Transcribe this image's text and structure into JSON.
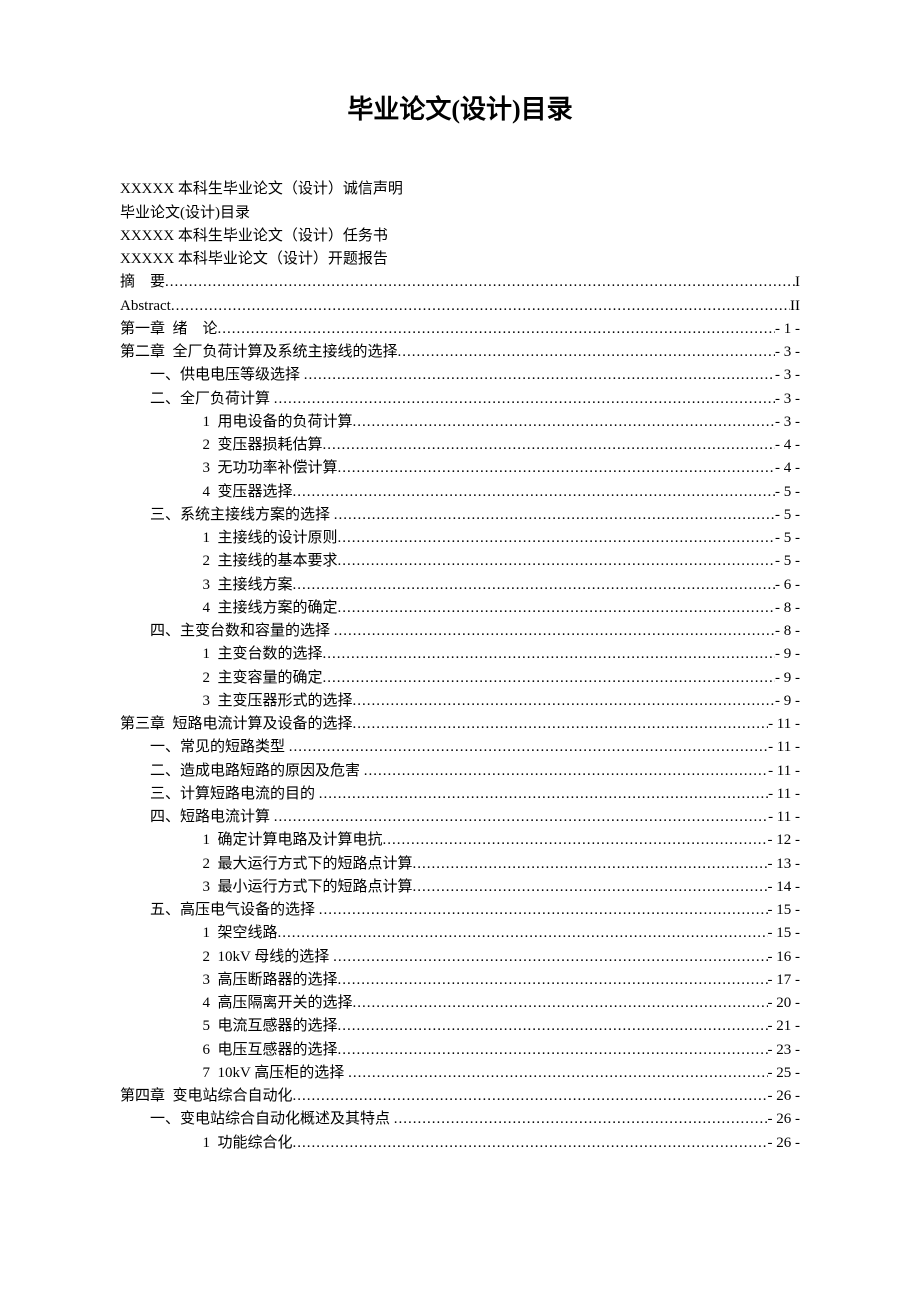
{
  "title": "毕业论文(设计)目录",
  "plain": [
    "XXXXX 本科生毕业论文（设计）诚信声明",
    "毕业论文(设计)目录",
    "XXXXX 本科生毕业论文（设计）任务书",
    "XXXXX 本科毕业论文（设计）开题报告"
  ],
  "toc": [
    {
      "label": "摘    要",
      "page": "I",
      "indent": 0
    },
    {
      "label": "Abstract",
      "page": "II",
      "indent": 0
    },
    {
      "label": "第一章  绪    论",
      "page": "- 1 -",
      "indent": 0
    },
    {
      "label": "第二章  全厂负荷计算及系统主接线的选择",
      "page": "- 3 -",
      "indent": 0
    },
    {
      "label": "一、供电电压等级选择 ",
      "page": "- 3 -",
      "indent": 1
    },
    {
      "label": "二、全厂负荷计算 ",
      "page": "- 3 -",
      "indent": 1
    },
    {
      "label": "1  用电设备的负荷计算",
      "page": "- 3 -",
      "indent": 2
    },
    {
      "label": "2  变压器损耗估算",
      "page": "- 4 -",
      "indent": 2
    },
    {
      "label": "3  无功功率补偿计算",
      "page": "- 4 -",
      "indent": 2
    },
    {
      "label": "4  变压器选择",
      "page": "- 5 -",
      "indent": 2
    },
    {
      "label": "三、系统主接线方案的选择 ",
      "page": "- 5 -",
      "indent": 1
    },
    {
      "label": "1  主接线的设计原则",
      "page": "- 5 -",
      "indent": 2
    },
    {
      "label": "2  主接线的基本要求",
      "page": "- 5 -",
      "indent": 2
    },
    {
      "label": "3  主接线方案",
      "page": "- 6 -",
      "indent": 2
    },
    {
      "label": "4  主接线方案的确定",
      "page": "- 8 -",
      "indent": 2
    },
    {
      "label": "四、主变台数和容量的选择 ",
      "page": "- 8 -",
      "indent": 1
    },
    {
      "label": "1  主变台数的选择",
      "page": "- 9 -",
      "indent": 2
    },
    {
      "label": "2  主变容量的确定",
      "page": "- 9 -",
      "indent": 2
    },
    {
      "label": "3  主变压器形式的选择",
      "page": "- 9 -",
      "indent": 2
    },
    {
      "label": "第三章  短路电流计算及设备的选择",
      "page": "- 11 -",
      "indent": 0
    },
    {
      "label": "一、常见的短路类型 ",
      "page": "- 11 -",
      "indent": 1
    },
    {
      "label": "二、造成电路短路的原因及危害 ",
      "page": "- 11 -",
      "indent": 1
    },
    {
      "label": "三、计算短路电流的目的 ",
      "page": "- 11 -",
      "indent": 1
    },
    {
      "label": "四、短路电流计算 ",
      "page": "- 11 -",
      "indent": 1
    },
    {
      "label": "1  确定计算电路及计算电抗",
      "page": "- 12 -",
      "indent": 2
    },
    {
      "label": "2  最大运行方式下的短路点计算",
      "page": "- 13 -",
      "indent": 2
    },
    {
      "label": "3  最小运行方式下的短路点计算",
      "page": "- 14 -",
      "indent": 2
    },
    {
      "label": "五、高压电气设备的选择 ",
      "page": "- 15 -",
      "indent": 1
    },
    {
      "label": "1  架空线路",
      "page": "- 15 -",
      "indent": 2
    },
    {
      "label": "2  10kV 母线的选择 ",
      "page": "- 16 -",
      "indent": 2
    },
    {
      "label": "3  高压断路器的选择",
      "page": "- 17 -",
      "indent": 2
    },
    {
      "label": "4  高压隔离开关的选择",
      "page": "- 20 -",
      "indent": 2
    },
    {
      "label": "5  电流互感器的选择",
      "page": "- 21 -",
      "indent": 2
    },
    {
      "label": "6  电压互感器的选择",
      "page": "- 23 -",
      "indent": 2
    },
    {
      "label": "7  10kV 高压柜的选择 ",
      "page": "- 25 -",
      "indent": 2
    },
    {
      "label": "第四章  变电站综合自动化",
      "page": "- 26 -",
      "indent": 0
    },
    {
      "label": "一、变电站综合自动化概述及其特点 ",
      "page": "- 26 -",
      "indent": 1
    },
    {
      "label": "1  功能综合化",
      "page": "- 26 -",
      "indent": 2
    }
  ]
}
